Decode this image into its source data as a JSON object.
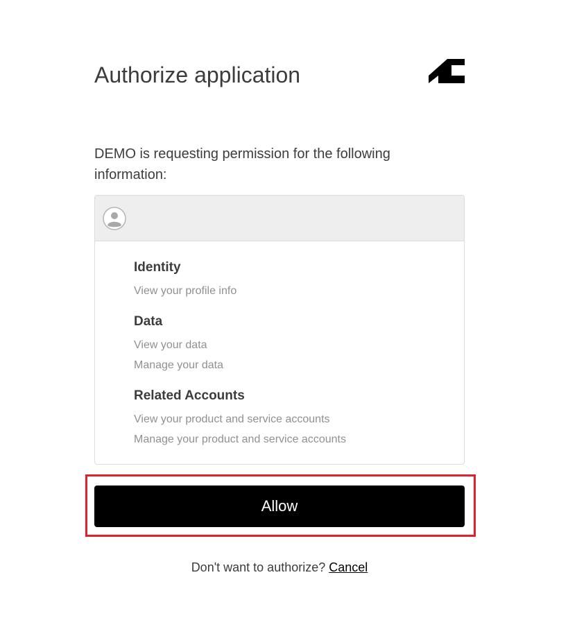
{
  "header": {
    "title": "Authorize application",
    "logo_icon": "autodesk-logo-icon"
  },
  "intro": {
    "text": "DEMO is requesting permission for the following information:"
  },
  "permissions": {
    "avatar_icon": "user-avatar-icon",
    "groups": [
      {
        "title": "Identity",
        "items": [
          "View your profile info"
        ]
      },
      {
        "title": "Data",
        "items": [
          "View your data",
          "Manage your data"
        ]
      },
      {
        "title": "Related Accounts",
        "items": [
          "View your product and service accounts",
          "Manage your product and service accounts"
        ]
      }
    ]
  },
  "actions": {
    "allow_label": "Allow",
    "highlight_color": "#e0202a"
  },
  "footer": {
    "prompt": "Don't want to authorize?",
    "cancel_label": "Cancel"
  }
}
